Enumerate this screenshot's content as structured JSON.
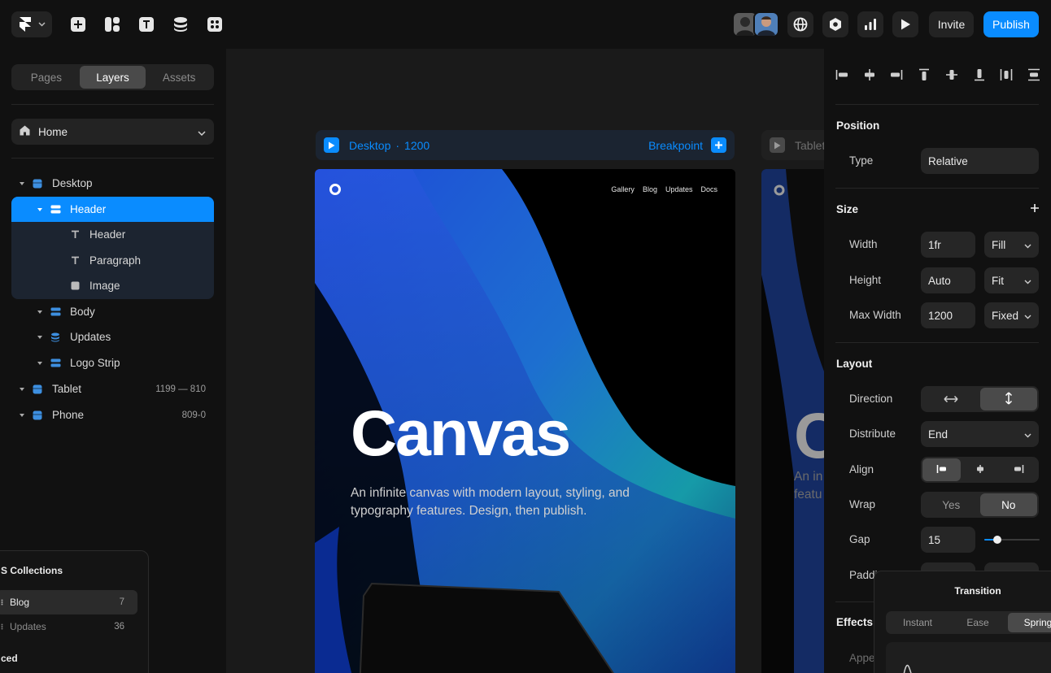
{
  "toolbar": {
    "tools": [
      "insert-icon",
      "layout-icon",
      "text-icon",
      "cms-icon",
      "components-icon"
    ],
    "right_icons": [
      "globe-icon",
      "settings-icon",
      "analytics-icon",
      "play-icon"
    ],
    "invite_label": "Invite",
    "publish_label": "Publish",
    "accent": "#0a8cff"
  },
  "left_panel": {
    "tabs": [
      {
        "label": "Pages",
        "active": false
      },
      {
        "label": "Layers",
        "active": true
      },
      {
        "label": "Assets",
        "active": false
      }
    ],
    "page_select": "Home",
    "layers": [
      {
        "label": "Desktop",
        "depth": 0,
        "icon": "breakpoint-icon",
        "right": ""
      },
      {
        "label": "Header",
        "depth": 1,
        "icon": "stack-icon",
        "right": "",
        "selected": true
      },
      {
        "label": "Header",
        "depth": 2,
        "icon": "text-icon",
        "right": ""
      },
      {
        "label": "Paragraph",
        "depth": 2,
        "icon": "text-icon",
        "right": ""
      },
      {
        "label": "Image",
        "depth": 2,
        "icon": "image-icon",
        "right": ""
      },
      {
        "label": "Body",
        "depth": 1,
        "icon": "stack-icon",
        "right": ""
      },
      {
        "label": "Updates",
        "depth": 1,
        "icon": "cms-icon",
        "right": ""
      },
      {
        "label": "Logo Strip",
        "depth": 1,
        "icon": "stack-icon",
        "right": ""
      },
      {
        "label": "Tablet",
        "depth": 0,
        "icon": "breakpoint-icon",
        "right": "1199 — 810"
      },
      {
        "label": "Phone",
        "depth": 0,
        "icon": "breakpoint-icon",
        "right": "809-0"
      }
    ],
    "cms": {
      "title": "S Collections",
      "rows": [
        {
          "label": "Blog",
          "count": "7"
        },
        {
          "label": "Updates",
          "count": "36"
        }
      ],
      "footer": "ced"
    }
  },
  "canvas": {
    "breakpoint_label": "Desktop",
    "breakpoint_width": "1200",
    "breakpoint_action": "Breakpoint",
    "second_breakpoint_label": "Tablet",
    "site_nav": [
      "Gallery",
      "Blog",
      "Updates",
      "Docs"
    ],
    "hero_title": "Canvas",
    "hero_text": "An infinite canvas with modern layout, styling, and typography features. Design, then publish.",
    "tablet_title": "C",
    "tablet_text": "An in layou featu"
  },
  "right_panel": {
    "align_icons": [
      "align-left-icon",
      "align-center-h-icon",
      "align-right-icon",
      "align-top-icon",
      "align-middle-icon",
      "align-bottom-icon",
      "distribute-h-icon",
      "distribute-v-icon"
    ],
    "position": {
      "title": "Position",
      "type_label": "Type",
      "type_value": "Relative"
    },
    "size": {
      "title": "Size",
      "width_label": "Width",
      "width_value": "1fr",
      "width_mode": "Fill",
      "height_label": "Height",
      "height_value": "Auto",
      "height_mode": "Fit",
      "maxw_label": "Max Width",
      "maxw_value": "1200",
      "maxw_mode": "Fixed"
    },
    "layout": {
      "title": "Layout",
      "direction_label": "Direction",
      "distribute_label": "Distribute",
      "distribute_value": "End",
      "align_label": "Align",
      "wrap_label": "Wrap",
      "wrap_yes": "Yes",
      "wrap_no": "No",
      "gap_label": "Gap",
      "gap_value": "15",
      "padding_label": "Paddi"
    },
    "effects_title": "Effects",
    "appear_label": "Appe",
    "transition": {
      "title": "Transition",
      "options": [
        "Instant",
        "Ease",
        "Spring"
      ],
      "selected": "Spring"
    }
  }
}
